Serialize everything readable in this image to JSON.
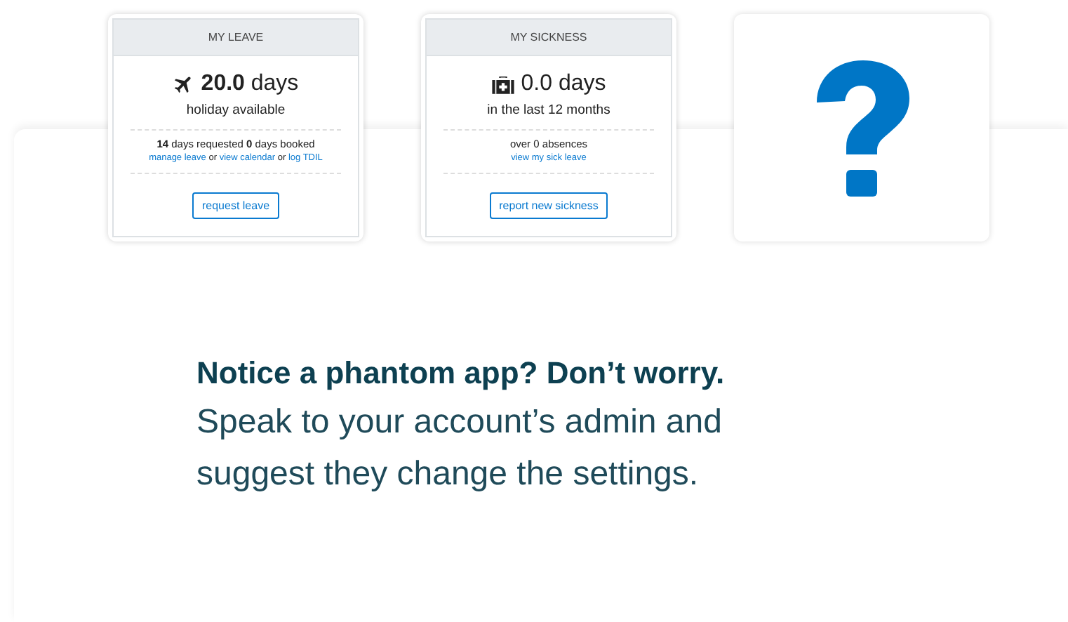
{
  "cards": [
    {
      "kind": "leave",
      "header": "MY LEAVE",
      "amount": "**20.0** days",
      "subtitle": "holiday available",
      "summary": "**14** days requested **0** days booked",
      "links": [
        {
          "kind": "link",
          "text": "manage leave"
        },
        {
          "kind": "text",
          "text": " or "
        },
        {
          "kind": "link",
          "text": "view calendar"
        },
        {
          "kind": "text",
          "text": " or "
        },
        {
          "kind": "link",
          "text": "log TDIL"
        }
      ],
      "button": "request leave"
    },
    {
      "kind": "sickness",
      "header": "MY SICKNESS",
      "amount": "0.0 days",
      "subtitle": "in the last 12 months",
      "summary": "over 0 absences",
      "links": [
        {
          "kind": "link",
          "text": "view my sick leave"
        }
      ],
      "button": "report new sickness"
    },
    {
      "kind": "unknown"
    }
  ],
  "message": {
    "title": "Notice a phantom app? Don’t worry.",
    "body": "Speak to your account’s admin and suggest they change the settings."
  }
}
